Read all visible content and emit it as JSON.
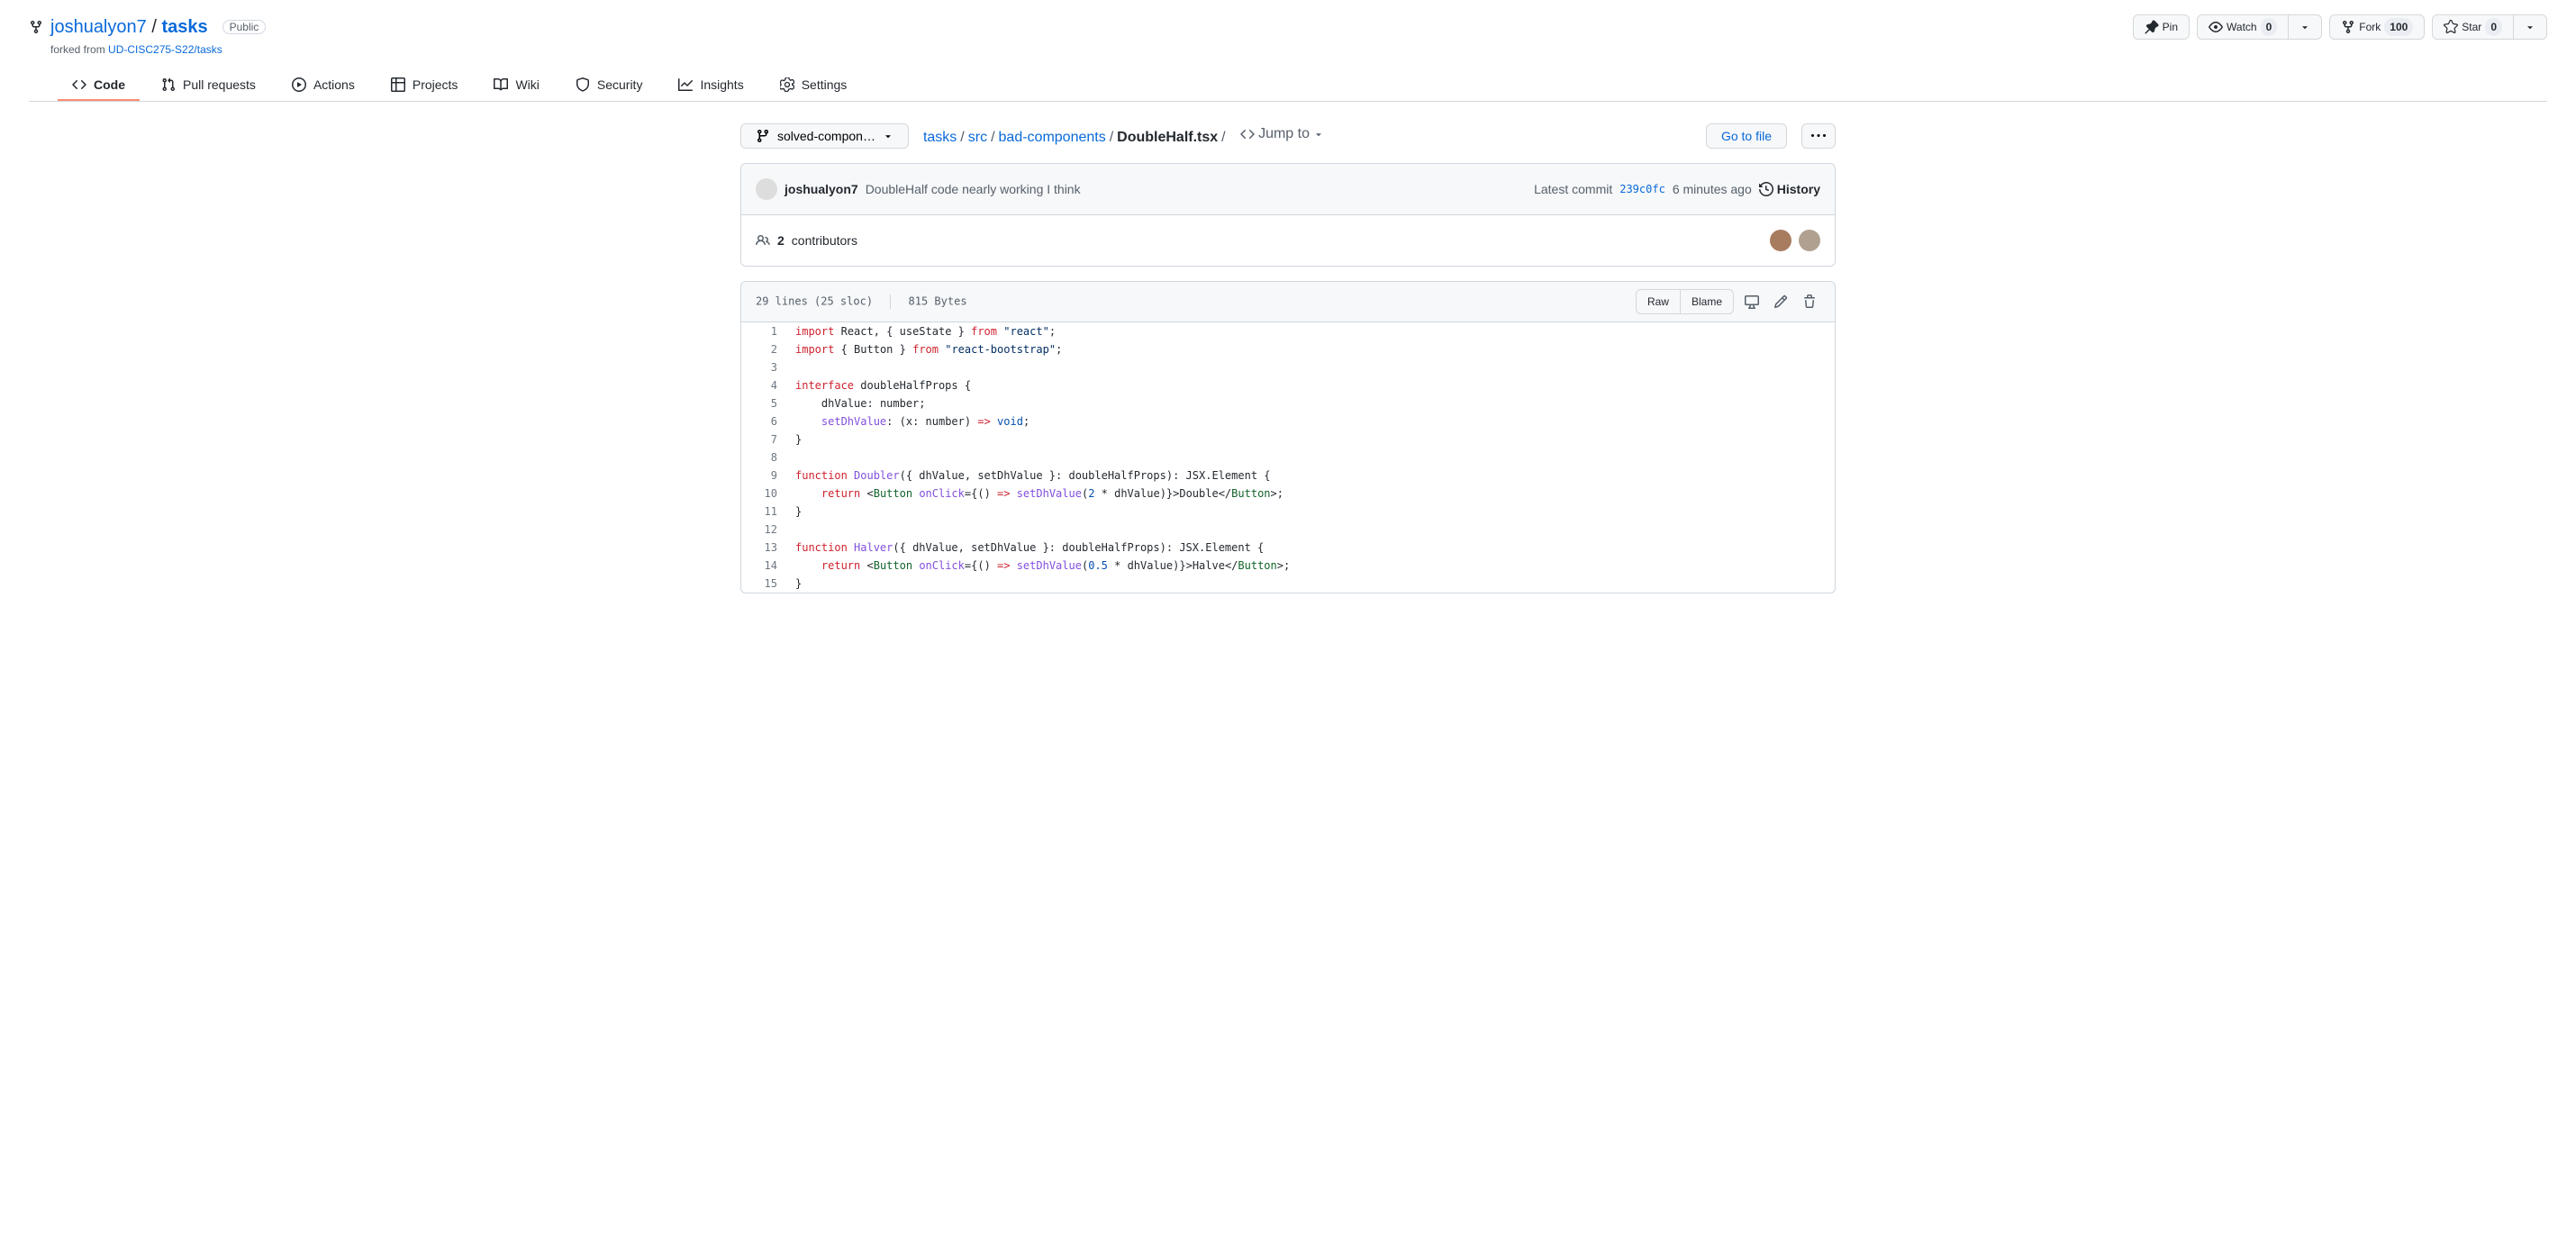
{
  "repo": {
    "owner": "joshualyon7",
    "name": "tasks",
    "visibility": "Public",
    "forked_label": "forked from",
    "forked_from": "UD-CISC275-S22/tasks"
  },
  "page_actions": {
    "pin": "Pin",
    "watch": "Watch",
    "watch_count": "0",
    "fork": "Fork",
    "fork_count": "100",
    "star": "Star",
    "star_count": "0"
  },
  "nav": {
    "code": "Code",
    "pull": "Pull requests",
    "actions": "Actions",
    "projects": "Projects",
    "wiki": "Wiki",
    "security": "Security",
    "insights": "Insights",
    "settings": "Settings"
  },
  "branch": "solved-compon…",
  "breadcrumb": {
    "root": "tasks",
    "src": "src",
    "bad": "bad-components",
    "file": "DoubleHalf.tsx"
  },
  "jump_to": "Jump to",
  "go_to_file": "Go to file",
  "commit": {
    "author": "joshualyon7",
    "message": "DoubleHalf code nearly working I think",
    "latest_label": "Latest commit",
    "sha": "239c0fc",
    "time": "6 minutes ago",
    "history": "History"
  },
  "contributors": {
    "count": "2",
    "label": "contributors"
  },
  "blob_info": {
    "lines": "29 lines (25 sloc)",
    "bytes": "815 Bytes"
  },
  "blob_actions": {
    "raw": "Raw",
    "blame": "Blame"
  },
  "code_lines": [
    {
      "n": "1",
      "html": "<span class=\"pl-k\">import</span> <span class=\"pl-smi\">React</span>, { <span class=\"pl-smi\">useState</span> } <span class=\"pl-k\">from</span> <span class=\"pl-s\">\"react\"</span>;"
    },
    {
      "n": "2",
      "html": "<span class=\"pl-k\">import</span> { <span class=\"pl-smi\">Button</span> } <span class=\"pl-k\">from</span> <span class=\"pl-s\">\"react-bootstrap\"</span>;"
    },
    {
      "n": "3",
      "html": ""
    },
    {
      "n": "4",
      "html": "<span class=\"pl-k\">interface</span> <span class=\"pl-smi\">doubleHalfProps</span> {"
    },
    {
      "n": "5",
      "html": "    <span class=\"pl-smi\">dhValue</span>: <span class=\"pl-smi\">number</span>;"
    },
    {
      "n": "6",
      "html": "    <span class=\"pl-en\">setDhValue</span>: (<span class=\"pl-smi\">x</span>: <span class=\"pl-smi\">number</span>) <span class=\"pl-k\">=&gt;</span> <span class=\"pl-c1\">void</span>;"
    },
    {
      "n": "7",
      "html": "}"
    },
    {
      "n": "8",
      "html": ""
    },
    {
      "n": "9",
      "html": "<span class=\"pl-k\">function</span> <span class=\"pl-en\">Doubler</span>({ <span class=\"pl-smi\">dhValue</span>, <span class=\"pl-smi\">setDhValue</span> }: <span class=\"pl-smi\">doubleHalfProps</span>): <span class=\"pl-smi\">JSX</span>.<span class=\"pl-smi\">Element</span> {"
    },
    {
      "n": "10",
      "html": "    <span class=\"pl-k\">return</span> &lt;<span class=\"pl-ent\">Button</span> <span class=\"pl-en\">onClick</span>={() <span class=\"pl-k\">=&gt;</span> <span class=\"pl-en\">setDhValue</span>(<span class=\"pl-c1\">2</span> * <span class=\"pl-smi\">dhValue</span>)}&gt;Double&lt;/<span class=\"pl-ent\">Button</span>&gt;;"
    },
    {
      "n": "11",
      "html": "}"
    },
    {
      "n": "12",
      "html": ""
    },
    {
      "n": "13",
      "html": "<span class=\"pl-k\">function</span> <span class=\"pl-en\">Halver</span>({ <span class=\"pl-smi\">dhValue</span>, <span class=\"pl-smi\">setDhValue</span> }: <span class=\"pl-smi\">doubleHalfProps</span>): <span class=\"pl-smi\">JSX</span>.<span class=\"pl-smi\">Element</span> {"
    },
    {
      "n": "14",
      "html": "    <span class=\"pl-k\">return</span> &lt;<span class=\"pl-ent\">Button</span> <span class=\"pl-en\">onClick</span>={() <span class=\"pl-k\">=&gt;</span> <span class=\"pl-en\">setDhValue</span>(<span class=\"pl-c1\">0.5</span> * <span class=\"pl-smi\">dhValue</span>)}&gt;Halve&lt;/<span class=\"pl-ent\">Button</span>&gt;;"
    },
    {
      "n": "15",
      "html": "}"
    }
  ]
}
